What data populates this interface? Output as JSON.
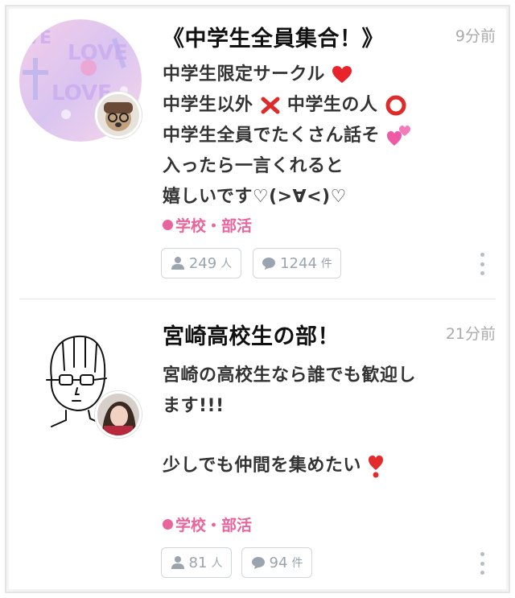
{
  "posts": [
    {
      "title": "《中学生全員集合！》",
      "time": "9分前",
      "body_lines": [
        "中学生限定サークル",
        "中学生以外",
        "中学生の人",
        "中学生全員でたくさん話そ",
        "入ったら一言くれると",
        "嬉しいです♡(>∀<)♡"
      ],
      "category": "学校・部活",
      "members": "249",
      "members_unit": "人",
      "posts_count": "1244",
      "posts_unit": "件",
      "avatar_icon": "love-pastel-avatar",
      "owner_icon": "owner-avatar"
    },
    {
      "title": "宮崎高校生の部！",
      "time": "21分前",
      "body_lines": [
        "宮崎の高校生なら誰でも歓迎し",
        "ます!!!",
        "",
        "少しでも仲間を集めたい"
      ],
      "category": "学校・部活",
      "members": "81",
      "members_unit": "人",
      "posts_count": "94",
      "posts_unit": "件",
      "avatar_icon": "sketch-face-avatar",
      "owner_icon": "owner-avatar"
    }
  ],
  "colors": {
    "category": "#e8649c",
    "pill_text": "#9aa4ae",
    "time": "#aaaaaa"
  }
}
